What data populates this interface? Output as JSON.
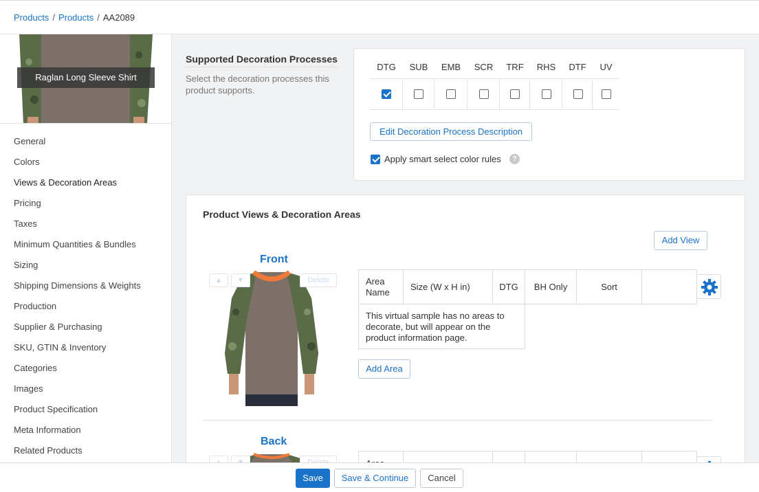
{
  "breadcrumb": {
    "items": [
      "Products",
      "Products"
    ],
    "current": "AA2089",
    "separator": "/"
  },
  "product": {
    "caption": "Raglan Long Sleeve Shirt"
  },
  "sidebar": {
    "items": [
      {
        "label": "General"
      },
      {
        "label": "Colors"
      },
      {
        "label": "Views & Decoration Areas",
        "active": true
      },
      {
        "label": "Pricing"
      },
      {
        "label": "Taxes"
      },
      {
        "label": "Minimum Quantities & Bundles"
      },
      {
        "label": "Sizing"
      },
      {
        "label": "Shipping Dimensions & Weights"
      },
      {
        "label": "Production"
      },
      {
        "label": "Supplier & Purchasing"
      },
      {
        "label": "SKU, GTIN & Inventory"
      },
      {
        "label": "Categories"
      },
      {
        "label": "Images"
      },
      {
        "label": "Product Specification"
      },
      {
        "label": "Meta Information"
      },
      {
        "label": "Related Products"
      }
    ]
  },
  "decoration": {
    "title": "Supported Decoration Processes",
    "description": "Select the decoration processes this product supports.",
    "processes": [
      {
        "code": "DTG",
        "checked": true
      },
      {
        "code": "SUB",
        "checked": false
      },
      {
        "code": "EMB",
        "checked": false
      },
      {
        "code": "SCR",
        "checked": false
      },
      {
        "code": "TRF",
        "checked": false
      },
      {
        "code": "RHS",
        "checked": false
      },
      {
        "code": "DTF",
        "checked": false
      },
      {
        "code": "UV",
        "checked": false
      }
    ],
    "edit_button": "Edit Decoration Process Description",
    "smart_select_label": "Apply smart select color rules",
    "smart_select_checked": true,
    "help_glyph": "?"
  },
  "views": {
    "title": "Product Views & Decoration Areas",
    "add_view": "Add View",
    "controls": {
      "up": "▲",
      "down": "▼",
      "delete": "Delete"
    },
    "table_headers": [
      "Area Name",
      "Size (W x H in)",
      "DTG",
      "BH Only",
      "Sort",
      ""
    ],
    "items": [
      {
        "name": "Front",
        "empty_message": "This virtual sample has no areas to decorate, but will appear on the product information page.",
        "add_area": "Add Area"
      },
      {
        "name": "Back",
        "partial_header": "Area"
      }
    ]
  },
  "footer": {
    "save": "Save",
    "save_continue": "Save & Continue",
    "cancel": "Cancel"
  },
  "colors": {
    "accent": "#1a73c8",
    "shirt_body": "#7d7068",
    "sleeve_camo": "#5a6b48",
    "collar_orange": "#f07a3a"
  }
}
